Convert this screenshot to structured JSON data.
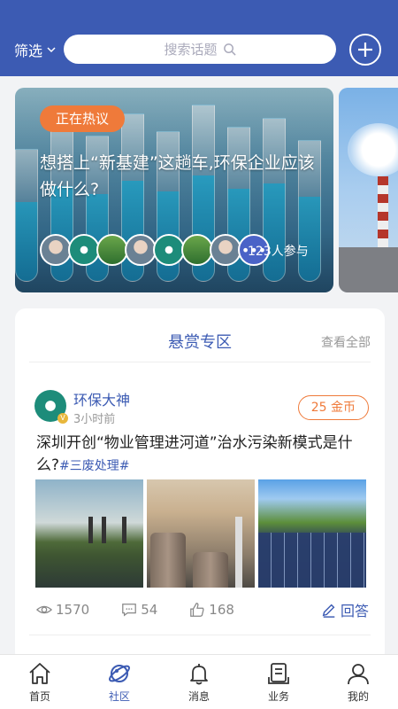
{
  "header": {
    "filter_label": "筛选",
    "search_placeholder": "搜索话题",
    "colors": {
      "primary": "#3c5bb3",
      "accent": "#ef7a3a"
    }
  },
  "banner": {
    "tag": "正在热议",
    "title": "想搭上“新基建”这趟车,环保企业应该做什么?",
    "participants": "123人参与",
    "more_glyph": "•••"
  },
  "bounty": {
    "title": "悬赏专区",
    "view_all": "查看全部",
    "post": {
      "author": "环保大神",
      "badge": "V",
      "time": "3小时前",
      "reward": "25 金币",
      "question": "深圳开创“物业管理进河道”治水污染新模式是什么?",
      "tag": "#三废处理#",
      "views": "1570",
      "comments": "54",
      "likes": "168",
      "answer_label": "回答"
    }
  },
  "tabbar": {
    "items": [
      {
        "label": "首页",
        "icon": "home-icon"
      },
      {
        "label": "社区",
        "icon": "planet-icon",
        "active": true
      },
      {
        "label": "消息",
        "icon": "bell-icon"
      },
      {
        "label": "业务",
        "icon": "document-icon"
      },
      {
        "label": "我的",
        "icon": "user-icon"
      }
    ]
  }
}
